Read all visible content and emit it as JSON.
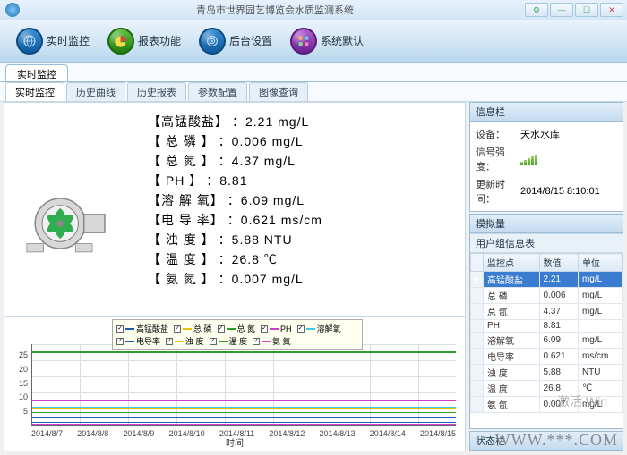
{
  "window": {
    "title": "青岛市世界园艺博览会水质监测系统"
  },
  "toolbar": {
    "realtime": "实时监控",
    "report": "报表功能",
    "backend": "后台设置",
    "default": "系统默认"
  },
  "outer_tab": "实时监控",
  "inner_tabs": [
    "实时监控",
    "历史曲线",
    "历史报表",
    "参数配置",
    "图像查询"
  ],
  "readings": [
    {
      "label": "【高锰酸盐】",
      "value": "：2.21 mg/L"
    },
    {
      "label": "【 总 磷 】",
      "value": "：0.006 mg/L"
    },
    {
      "label": "【 总 氮 】",
      "value": "：4.37 mg/L"
    },
    {
      "label": "【  PH  】",
      "value": "：8.81"
    },
    {
      "label": "【溶 解 氧】",
      "value": "：6.09 mg/L"
    },
    {
      "label": "【电 导 率】",
      "value": "：0.621 ms/cm"
    },
    {
      "label": "【 浊 度 】",
      "value": "：5.88 NTU"
    },
    {
      "label": "【 温 度 】",
      "value": "：26.8 ℃"
    },
    {
      "label": "【 氨 氮 】",
      "value": "：0.007 mg/L"
    }
  ],
  "info_panel": {
    "title": "信息栏",
    "device_label": "设备：",
    "device_value": "天水水库",
    "signal_label": "信号强度：",
    "time_label": "更新时间：",
    "time_value": "2014/8/15 8:10:01"
  },
  "analog_panel": {
    "title": "模拟量",
    "group_title": "用户组信息表",
    "columns": [
      "监控点",
      "数值",
      "单位"
    ],
    "rows": [
      {
        "name": "高锰酸盐",
        "value": "2.21",
        "unit": "mg/L",
        "selected": true
      },
      {
        "name": "总 磷",
        "value": "0.006",
        "unit": "mg/L"
      },
      {
        "name": "总 氮",
        "value": "4.37",
        "unit": "mg/L"
      },
      {
        "name": "PH",
        "value": "8.81",
        "unit": ""
      },
      {
        "name": "溶解氧",
        "value": "6.09",
        "unit": "mg/L"
      },
      {
        "name": "电导率",
        "value": "0.621",
        "unit": "ms/cm"
      },
      {
        "name": "浊 度",
        "value": "5.88",
        "unit": "NTU"
      },
      {
        "name": "温 度",
        "value": "26.8",
        "unit": "℃"
      },
      {
        "name": "氨 氮",
        "value": "0.007",
        "unit": "mg/L"
      }
    ]
  },
  "status_panel": {
    "title": "状态栏"
  },
  "chart_legend": [
    {
      "label": "高锰酸盐",
      "color": "#1b5fb3"
    },
    {
      "label": "总 磷",
      "color": "#e6c200"
    },
    {
      "label": "总 氮",
      "color": "#2aa02a"
    },
    {
      "label": "PH",
      "color": "#d03bd0"
    },
    {
      "label": "溶解氧",
      "color": "#40c8e8"
    },
    {
      "label": "电导率",
      "color": "#1b5fb3"
    },
    {
      "label": "浊 度",
      "color": "#e6c200"
    },
    {
      "label": "温 度",
      "color": "#2aa02a"
    },
    {
      "label": "氨 氮",
      "color": "#d03bd0"
    }
  ],
  "chart_data": {
    "type": "line",
    "xlabel": "时间",
    "x": [
      "2014/8/7",
      "2014/8/8",
      "2014/8/9",
      "2014/8/10",
      "2014/8/11",
      "2014/8/12",
      "2014/8/13",
      "2014/8/14",
      "2014/8/15"
    ],
    "ylim": [
      0,
      30
    ],
    "yticks": [
      5,
      10,
      15,
      20,
      25
    ],
    "series": [
      {
        "name": "高锰酸盐",
        "color": "#1b5fb3",
        "approx_level": 2.2
      },
      {
        "name": "总 磷",
        "color": "#e6c200",
        "approx_level": 0.0
      },
      {
        "name": "总 氮",
        "color": "#2aa02a",
        "approx_level": 4.3
      },
      {
        "name": "PH",
        "color": "#d03bd0",
        "approx_level": 8.8
      },
      {
        "name": "溶解氧",
        "color": "#40c8e8",
        "approx_level": 6.1
      },
      {
        "name": "电导率",
        "color": "#1b5fb3",
        "approx_level": 0.6
      },
      {
        "name": "浊 度",
        "color": "#e6c200",
        "approx_level": 5.9
      },
      {
        "name": "温 度",
        "color": "#2aa02a",
        "approx_level": 26.8
      },
      {
        "name": "氨 氮",
        "color": "#d03bd0",
        "approx_level": 0.0
      }
    ]
  },
  "watermark": "WWW.***.COM",
  "activate_hint": "激活 Win"
}
